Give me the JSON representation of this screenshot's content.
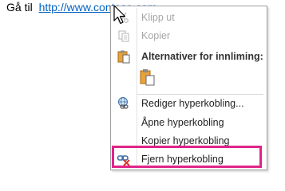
{
  "document": {
    "goto_text": "Gå til",
    "link_text": "http://www.contoso.com"
  },
  "context_menu": {
    "cut": {
      "label": "Klipp ut",
      "icon": "scissors-icon",
      "enabled": false
    },
    "copy": {
      "label": "Kopier",
      "icon": "copy-icon",
      "enabled": false
    },
    "paste_header": {
      "label": "Alternativer for innliming:",
      "icon": "clipboard-icon"
    },
    "paste_option": {
      "icon": "paste-keep-text-icon"
    },
    "edit_link": {
      "label": "Rediger hyperkobling...",
      "icon": "edit-hyperlink-icon"
    },
    "open_link": {
      "label": "Åpne hyperkobling"
    },
    "copy_link": {
      "label": "Kopier hyperkobling"
    },
    "remove_link": {
      "label": "Fjern hyperkobling",
      "icon": "remove-hyperlink-icon"
    }
  },
  "colors": {
    "link": "#0563c1",
    "highlight": "#e0248a",
    "disabled_text": "#a6a6a6"
  }
}
